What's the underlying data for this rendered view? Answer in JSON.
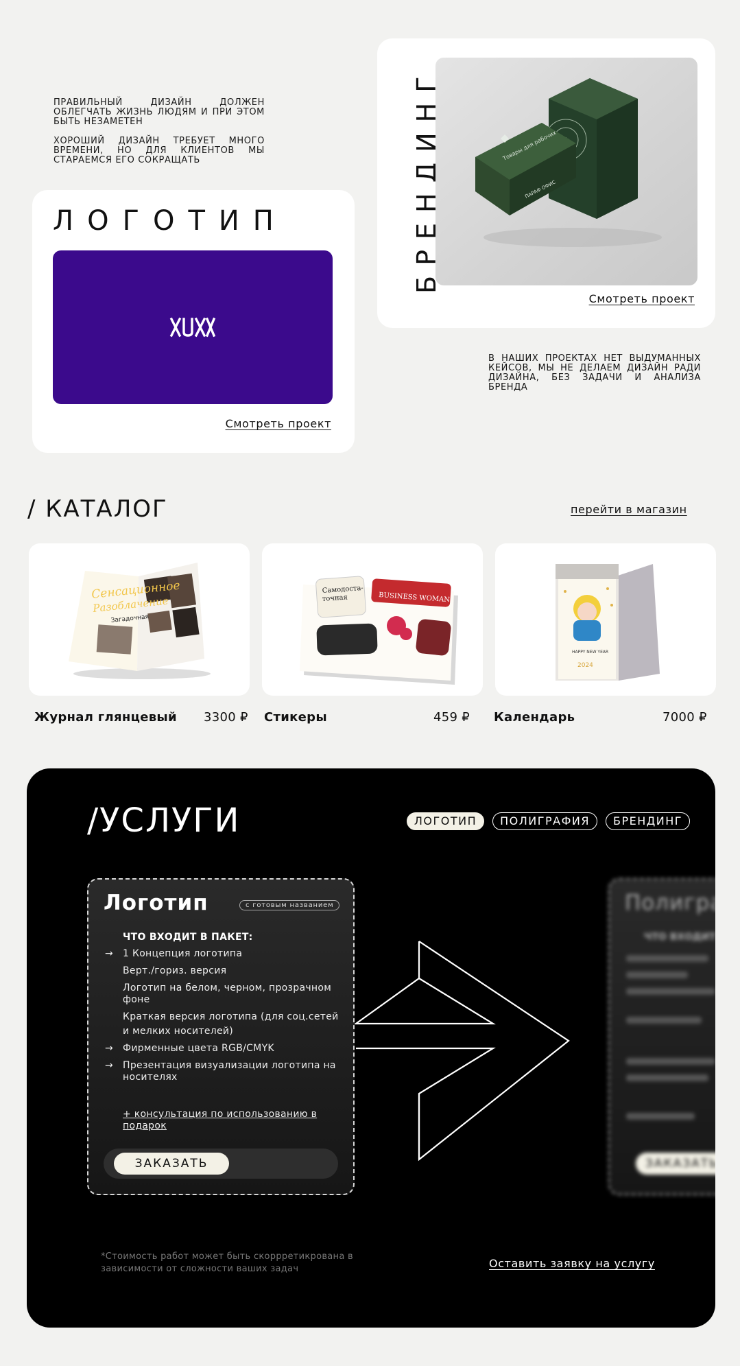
{
  "intro": {
    "p1": "Правильный дизайн должен облегчать жизнь людям и при этом быть незаметен",
    "p2": "Хороший дизайн требует много времени, но для клиентов мы стараемся его сокращать",
    "p3": "В наших проектах нет выдуманных кейсов, мы не делаем дизайн ради дизайна, без задачи и анализа бренда"
  },
  "logo_card": {
    "title": "ЛОГОТИП",
    "preview_mark": "XUXX",
    "link": "Смотреть проект",
    "preview_color": "#3b0a8c"
  },
  "brand_card": {
    "title": "БРЕНДИНГ",
    "link": "Смотреть проект",
    "box_color": "#2f4a2e"
  },
  "catalog": {
    "title": "/ КАТАЛОГ",
    "shop_link": "перейти в магазин",
    "items": [
      {
        "name": "Журнал глянцевый",
        "price": "3300 ₽"
      },
      {
        "name": "Стикеры",
        "price": "459 ₽"
      },
      {
        "name": "Календарь",
        "price": "7000 ₽"
      }
    ]
  },
  "services": {
    "title": "/УСЛУГИ",
    "tabs": [
      "ЛОГОТИП",
      "ПОЛИГРАФИЯ",
      "БРЕНДИНГ"
    ],
    "active_tab": "ЛОГОТИП",
    "card": {
      "title": "Логотип",
      "badge": "с готовым названием",
      "heading": "ЧТО ВХОДИТ В ПАКЕТ:",
      "items": [
        {
          "text": "1 Концепция логотипа",
          "arrow": true
        },
        {
          "text": "Верт./гориз. версия",
          "arrow": false
        },
        {
          "text": "Логотип на белом, черном, прозрачном фоне",
          "arrow": false
        },
        {
          "text": "Краткая версия логотипа (для соц.сетей",
          "arrow": false
        },
        {
          "text": "и мелких носителей)",
          "arrow": false
        },
        {
          "text": "Фирменные цвета RGB/CMYK",
          "arrow": true
        },
        {
          "text": "Презентация визуализации логотипа на носителях",
          "arrow": true
        }
      ],
      "extra": "+ консультация по использованию в подарок",
      "order_button": "ЗАКАЗАТЬ"
    },
    "next_card": {
      "title": "Полиграфия",
      "heading": "ЧТО ВХОДИТ",
      "order_button": "ЗАКАЗАТЬ"
    },
    "note": "*Стоимость работ может быть скоррретикрована в зависимости от сложности ваших задач",
    "request_link": "Оставить заявку на услугу"
  }
}
